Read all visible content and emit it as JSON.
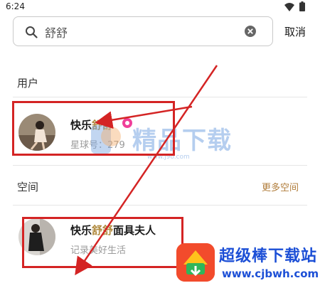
{
  "status_bar": {
    "time": "6:24"
  },
  "search": {
    "query": "舒舒",
    "cancel_label": "取消"
  },
  "users_section": {
    "title": "用户",
    "items": [
      {
        "name_prefix": "快乐",
        "name_highlight": "舒舒",
        "name_suffix": "",
        "subtitle": "星球号：279"
      }
    ]
  },
  "spaces_section": {
    "title": "空间",
    "more_label": "更多空间",
    "items": [
      {
        "name_prefix": "快乐",
        "name_highlight": "舒舒",
        "name_suffix": "面具夫人",
        "subtitle": "记录美好生活"
      }
    ]
  },
  "watermarks": {
    "center_text": "精品下载",
    "center_url": "www.j9o.com",
    "corner_title": "超级棒下载站",
    "corner_url": "www.cjbwh.com"
  },
  "colors": {
    "highlight": "#b08a3e",
    "annotation": "#d42424",
    "accent_link": "#b07c3a"
  }
}
